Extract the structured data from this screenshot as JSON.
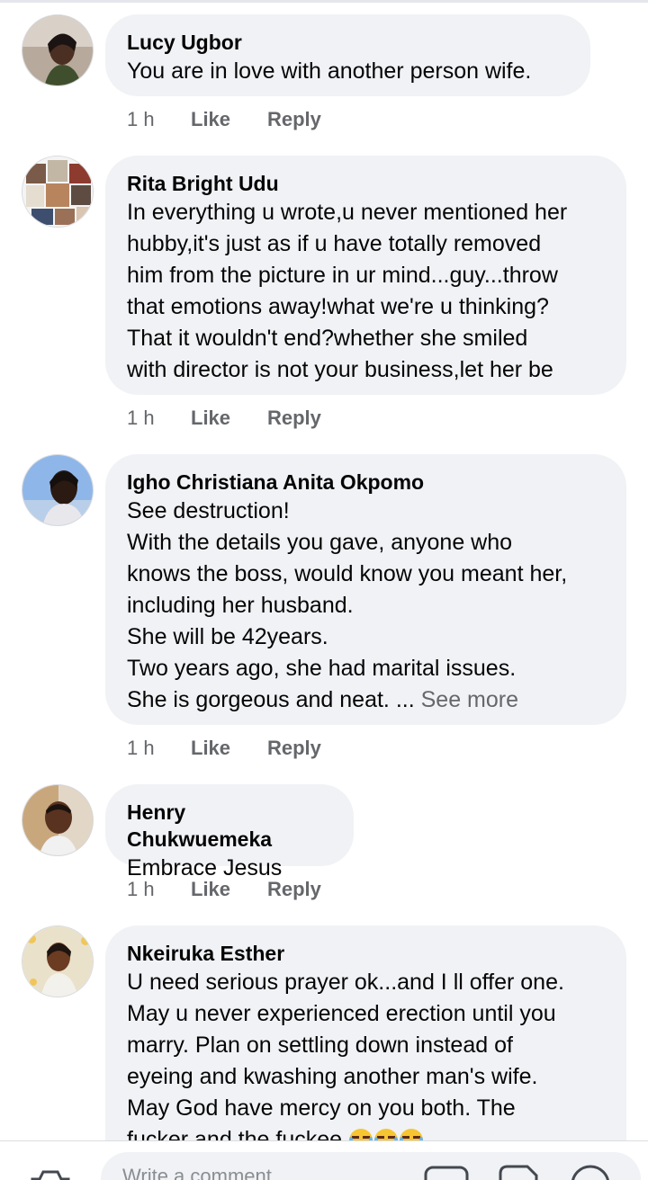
{
  "comments": [
    {
      "author": "Lucy Ugbor",
      "text": "You are in love with another person wife.",
      "time": "1 h",
      "like": "Like",
      "reply": "Reply"
    },
    {
      "author": "Rita Bright Udu",
      "text": "In everything u wrote,u never mentioned her\nhubby,it's just as if u have totally removed\nhim from the picture in ur mind...guy...throw\nthat emotions away!what we're u thinking?\nThat it wouldn't end?whether she smiled\nwith director is not your business,let her be",
      "time": "1 h",
      "like": "Like",
      "reply": "Reply"
    },
    {
      "author": "Igho Christiana Anita Okpomo",
      "text": "See destruction!\nWith the details you gave, anyone who\nknows the boss, would know you meant her,\nincluding her husband.\nShe will be 42years.\nTwo years ago, she had marital issues.\nShe is gorgeous and neat. ...",
      "see_more": "See more",
      "time": "1 h",
      "like": "Like",
      "reply": "Reply"
    },
    {
      "author": "Henry Chukwuemeka",
      "text": "Embrace Jesus",
      "time": "1 h",
      "like": "Like",
      "reply": "Reply"
    },
    {
      "author": "Nkeiruka Esther",
      "text": "U need serious prayer ok...and I ll offer one.\nMay u never experienced erection until you\nmarry. Plan on settling down instead of\neyeing and kwashing another man's wife.\nMay God have mercy on you both. The\nfucker and the fuckee",
      "emoji": "crying-laughing-emoji"
    }
  ],
  "composer": {
    "placeholder": "Write a comment...",
    "icons": [
      "camera-icon",
      "gif-icon",
      "sticker-icon",
      "emoji-icon"
    ]
  },
  "colors": {
    "bubble": "#f0f2f5",
    "secondary_text": "#65676b"
  }
}
